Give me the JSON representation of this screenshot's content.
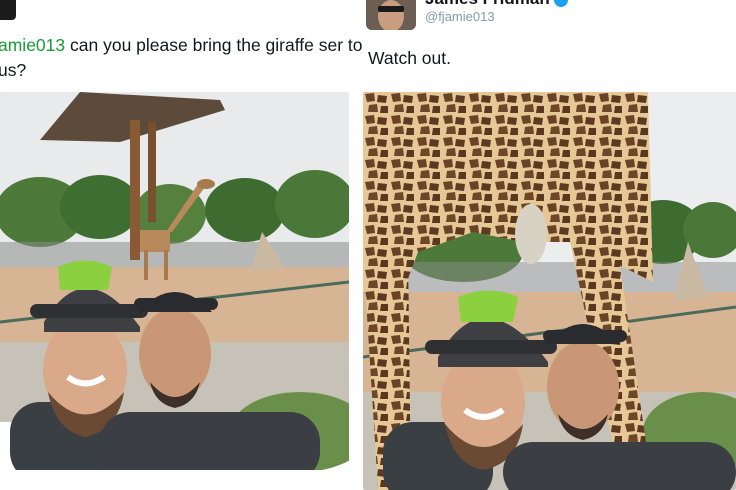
{
  "left_tweet": {
    "mention": "amie013",
    "text": " can you please bring the giraffe ser to us?"
  },
  "right_tweet": {
    "display_name": "James Fridman",
    "handle": "@fjamie013",
    "text": "Watch out."
  },
  "icons": {
    "verified": "verified-badge-icon"
  },
  "colors": {
    "mention": "#1b9a3c",
    "handle": "#8899a6",
    "verified": "#1da1f2",
    "cap_green": "#7cc43a",
    "sky": "#e9ecef",
    "ground": "#d9b89b"
  }
}
